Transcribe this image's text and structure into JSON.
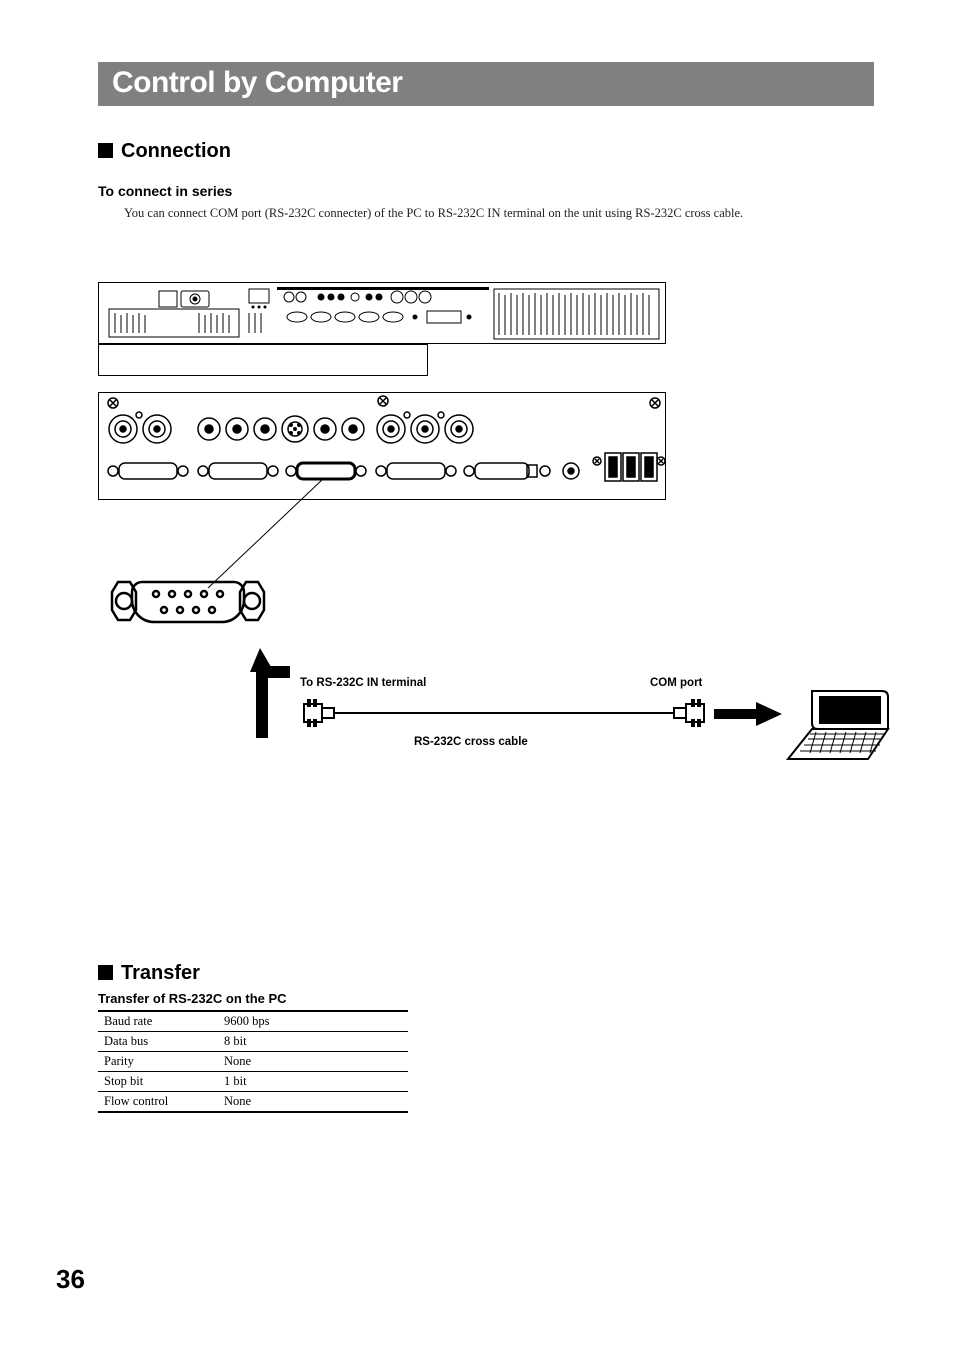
{
  "title": "Control by Computer",
  "sections": {
    "connection": {
      "heading": "Connection",
      "sub": "To connect in series",
      "body": "You can connect COM port (RS-232C connecter) of the PC to RS-232C IN terminal on the unit using RS-232C cross cable."
    },
    "transfer": {
      "heading": "Transfer",
      "caption": "Transfer of RS-232C on the PC",
      "rows": [
        {
          "k": "Baud rate",
          "v": "9600 bps"
        },
        {
          "k": "Data bus",
          "v": "8 bit"
        },
        {
          "k": "Parity",
          "v": "None"
        },
        {
          "k": "Stop bit",
          "v": "1 bit"
        },
        {
          "k": "Flow control",
          "v": "None"
        }
      ]
    }
  },
  "diagram": {
    "to_terminal_label": "To RS-232C IN terminal",
    "com_port_label": "COM port",
    "cable_label": "RS-232C cross cable"
  },
  "page_number": "36"
}
